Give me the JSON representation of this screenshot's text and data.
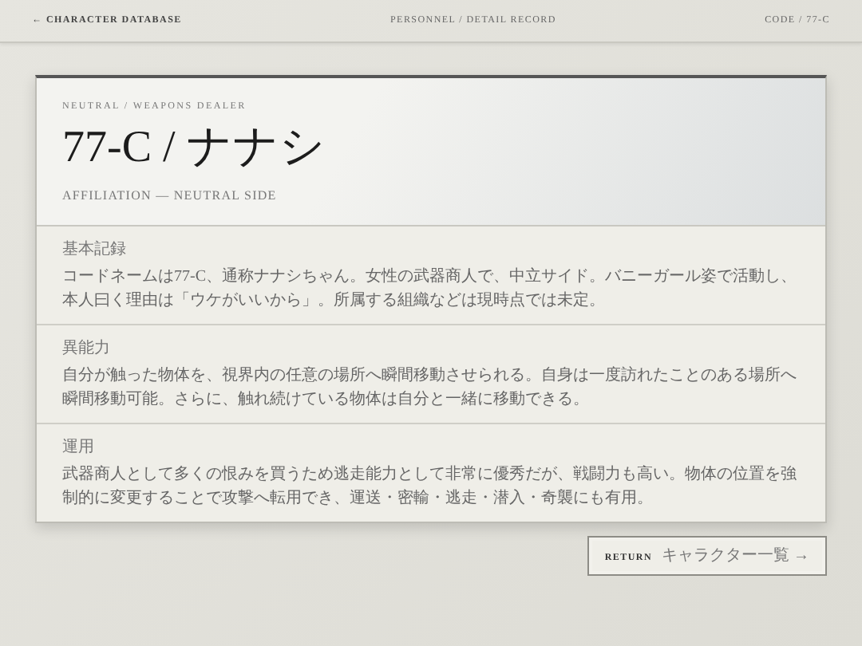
{
  "top_bar": {
    "back_link": "← CHARACTER DATABASE",
    "breadcrumb": "PERSONNEL / DETAIL RECORD",
    "code": "CODE / 77-C"
  },
  "record": {
    "category": "NEUTRAL / WEAPONS DEALER",
    "name": "77-C / ナナシ",
    "affiliation": "AFFILIATION — NEUTRAL SIDE",
    "sections": [
      {
        "label": "基本記録",
        "text": "コードネームは77-C、通称ナナシちゃん。女性の武器商人で、中立サイド。バニーガール姿で活動し、本人曰く理由は「ウケがいいから」。所属する組織などは現時点では未定。"
      },
      {
        "label": "異能力",
        "text": "自分が触った物体を、視界内の任意の場所へ瞬間移動させられる。自身は一度訪れたことのある場所へ瞬間移動可能。さらに、触れ続けている物体は自分と一緒に移動できる。"
      },
      {
        "label": "運用",
        "text": "武器商人として多くの恨みを買うため逃走能力として非常に優秀だが、戦闘力も高い。物体の位置を強制的に変更することで攻撃へ転用でき、運送・密輸・逃走・潜入・奇襲にも有用。"
      }
    ]
  },
  "return_button": {
    "label": "RETURN",
    "text": "キャラクター一覧 →"
  }
}
